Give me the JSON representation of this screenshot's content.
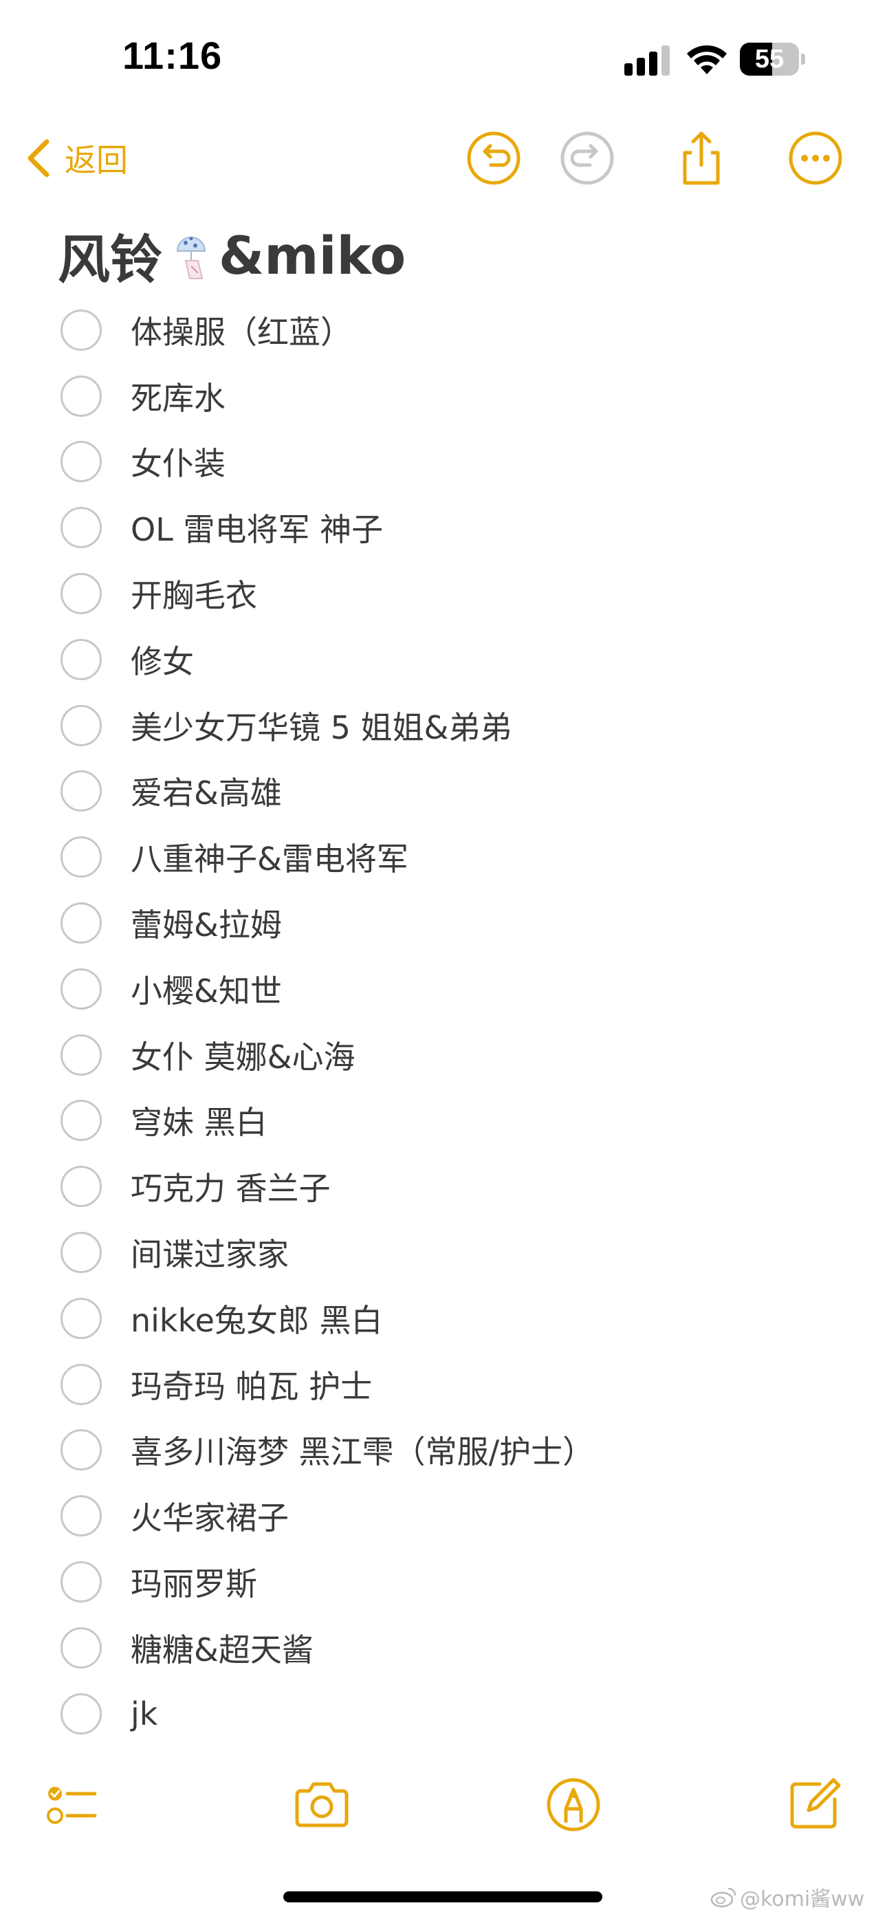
{
  "status_bar": {
    "time": "11:16",
    "battery_level": "55",
    "battery_fraction": 0.55,
    "icons": [
      "signal-icon",
      "wifi-icon",
      "battery-icon"
    ]
  },
  "nav": {
    "back_label": "返回",
    "icons": [
      "chevron-left-icon",
      "undo-icon",
      "redo-icon",
      "share-icon",
      "more-icon"
    ]
  },
  "note": {
    "title_prefix": "风铃",
    "title_emoji": "wind-chime-icon",
    "title_suffix": "&miko",
    "items": [
      {
        "label": "体操服（红蓝）",
        "checked": false
      },
      {
        "label": "死库水",
        "checked": false
      },
      {
        "label": "女仆装",
        "checked": false
      },
      {
        "label": "OL 雷电将军 神子",
        "checked": false
      },
      {
        "label": "开胸毛衣",
        "checked": false
      },
      {
        "label": "修女",
        "checked": false
      },
      {
        "label": "美少女万华镜 5 姐姐&弟弟",
        "checked": false
      },
      {
        "label": "爱宕&高雄",
        "checked": false
      },
      {
        "label": "八重神子&雷电将军",
        "checked": false
      },
      {
        "label": "蕾姆&拉姆",
        "checked": false
      },
      {
        "label": "小樱&知世",
        "checked": false
      },
      {
        "label": "女仆 莫娜&心海",
        "checked": false
      },
      {
        "label": "穹妹 黑白",
        "checked": false
      },
      {
        "label": "巧克力 香兰子",
        "checked": false
      },
      {
        "label": "间谍过家家",
        "checked": false
      },
      {
        "label": "nikke兔女郎 黑白",
        "checked": false
      },
      {
        "label": "玛奇玛 帕瓦 护士",
        "checked": false
      },
      {
        "label": "喜多川海梦 黑江雫（常服/护士）",
        "checked": false
      },
      {
        "label": "火华家裙子",
        "checked": false
      },
      {
        "label": "玛丽罗斯",
        "checked": false
      },
      {
        "label": "糖糖&超天酱",
        "checked": false
      },
      {
        "label": "jk",
        "checked": false
      }
    ]
  },
  "toolbar": {
    "icons": [
      "checklist-icon",
      "camera-icon",
      "markup-icon",
      "compose-icon"
    ]
  },
  "watermark": {
    "text": "@komi酱ww"
  },
  "colors": {
    "accent": "#e8a80b",
    "disabled": "#c7c7cc",
    "text": "#3a3a3c",
    "background": "#ffffff"
  }
}
